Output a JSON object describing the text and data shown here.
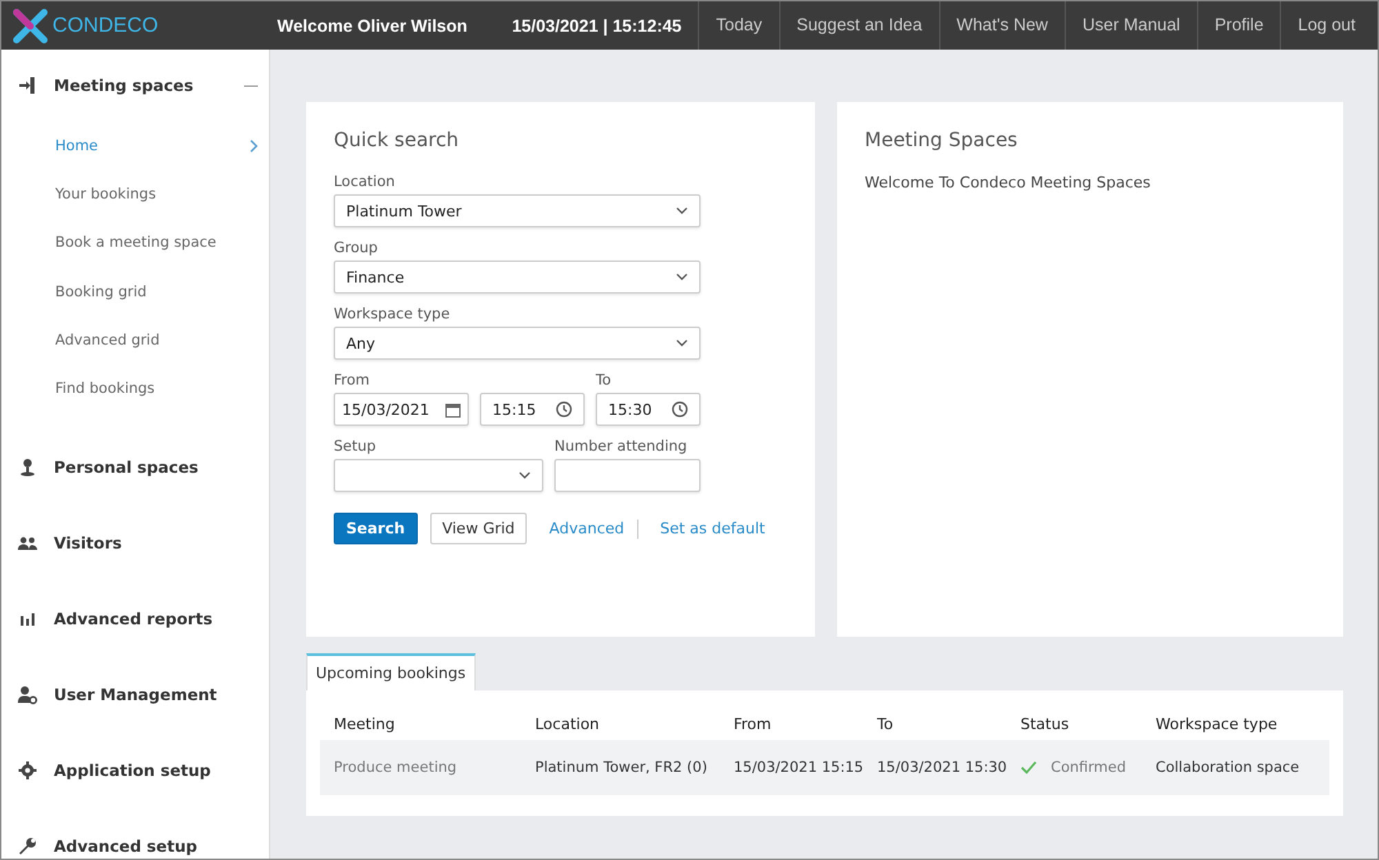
{
  "header": {
    "logo": "CONDECO",
    "welcome": "Welcome Oliver Wilson",
    "datetime": "15/03/2021 | 15:12:45",
    "links": [
      "Today",
      "Suggest an Idea",
      "What's New",
      "User Manual",
      "Profile",
      "Log out"
    ]
  },
  "sidebar": {
    "groups": [
      {
        "label": "Meeting spaces",
        "expanded": true,
        "children": [
          {
            "label": "Home",
            "selected": true
          },
          {
            "label": "Your bookings",
            "selected": false
          },
          {
            "label": "Book a meeting space",
            "selected": false
          },
          {
            "label": "Booking grid",
            "selected": false
          },
          {
            "label": "Advanced grid",
            "selected": false
          },
          {
            "label": "Find bookings",
            "selected": false
          }
        ]
      },
      {
        "label": "Personal spaces",
        "expanded": false
      },
      {
        "label": "Visitors",
        "expanded": false
      },
      {
        "label": "Advanced reports",
        "expanded": false
      },
      {
        "label": "User Management",
        "expanded": false
      },
      {
        "label": "Application setup",
        "expanded": false
      },
      {
        "label": "Advanced setup",
        "expanded": false
      }
    ]
  },
  "quick_search": {
    "title": "Quick search",
    "location": {
      "label": "Location",
      "value": "Platinum Tower"
    },
    "group": {
      "label": "Group",
      "value": "Finance"
    },
    "workspace_type": {
      "label": "Workspace type",
      "value": "Any"
    },
    "from": {
      "label": "From",
      "date": "15/03/2021",
      "time": "15:15"
    },
    "to": {
      "label": "To",
      "time": "15:30"
    },
    "setup": {
      "label": "Setup"
    },
    "number_attending": {
      "label": "Number attending"
    },
    "primary_button": "Search",
    "secondary_button": "View Grid",
    "links": [
      "Advanced",
      "Set as default"
    ]
  },
  "meeting_spaces": {
    "title": "Meeting Spaces",
    "text": "Welcome To Condeco Meeting Spaces"
  },
  "upcoming": {
    "tab": "Upcoming bookings",
    "columns": [
      "Meeting",
      "Location",
      "From",
      "To",
      "Status",
      "Workspace type"
    ],
    "rows": [
      {
        "meeting": "Produce meeting",
        "location": "Platinum Tower, FR2 (0)",
        "from": "15/03/2021 15:15",
        "to": "15/03/2021 15:30",
        "status": "Confirmed",
        "confirmed": true,
        "workspace_type": "Collaboration space"
      }
    ]
  }
}
